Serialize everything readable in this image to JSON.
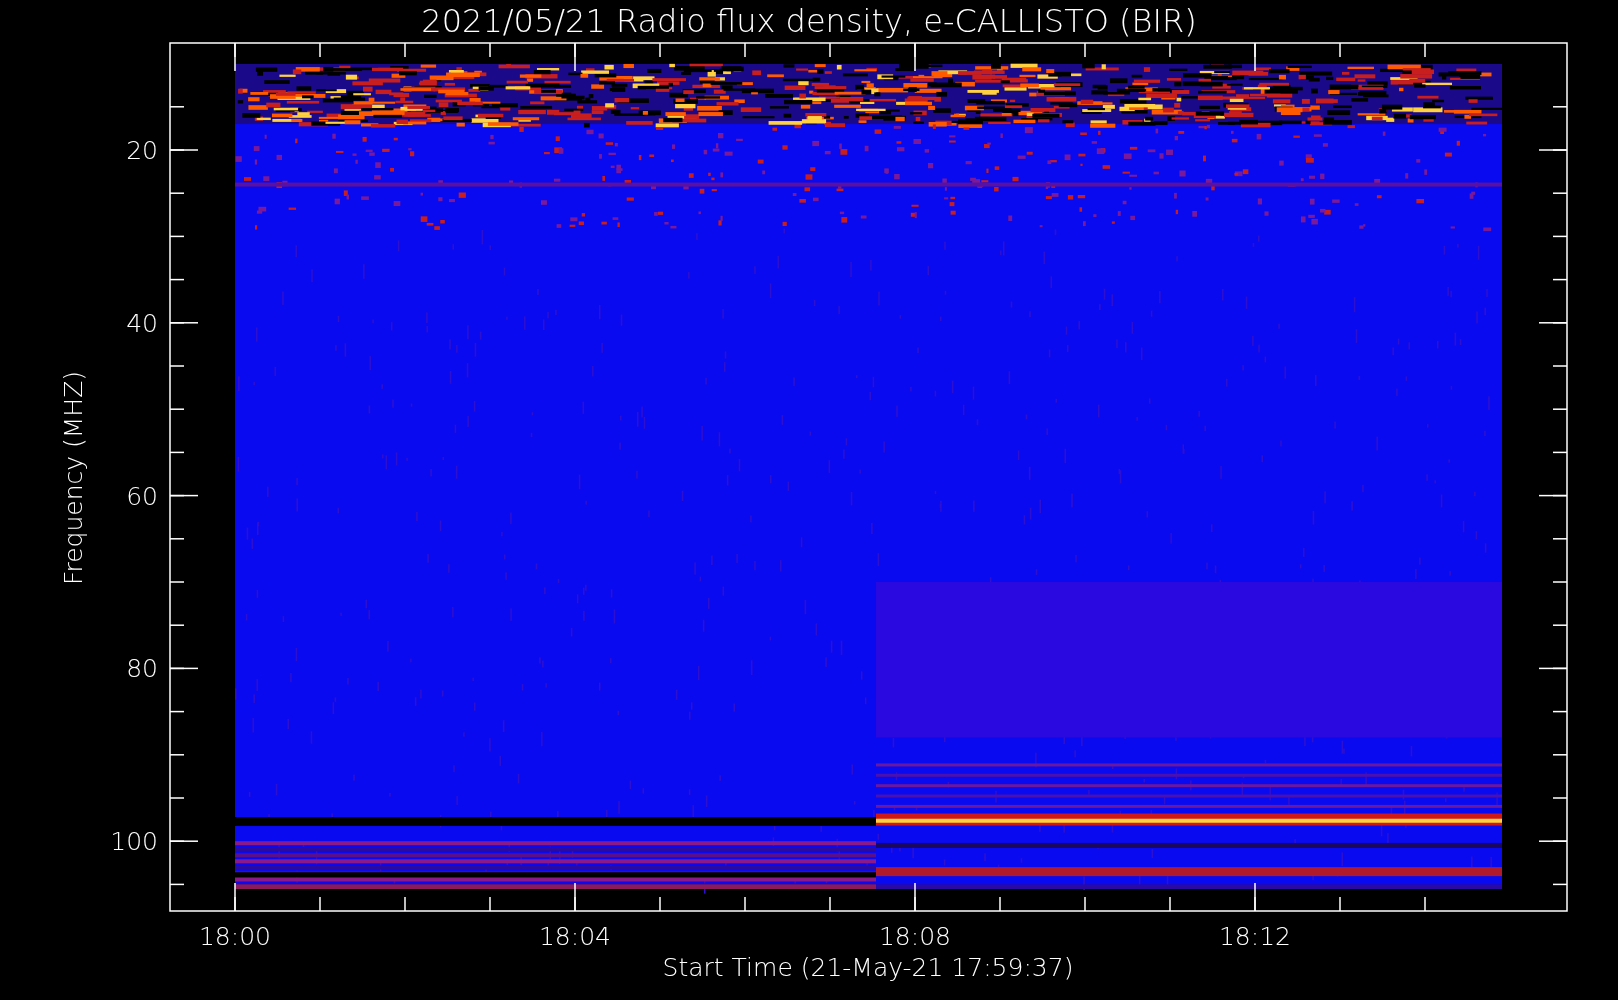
{
  "plot": {
    "title": "2021/05/21  Radio flux density, e-CALLISTO (BIR)",
    "y_axis": {
      "label": "Frequency (MHZ)",
      "ticks": [
        "20",
        "40",
        "60",
        "80",
        "100"
      ]
    },
    "x_axis": {
      "label": "Start Time (21-May-21 17:59:37)",
      "ticks": [
        "18:00",
        "18:04",
        "18:08",
        "18:12"
      ]
    }
  }
}
